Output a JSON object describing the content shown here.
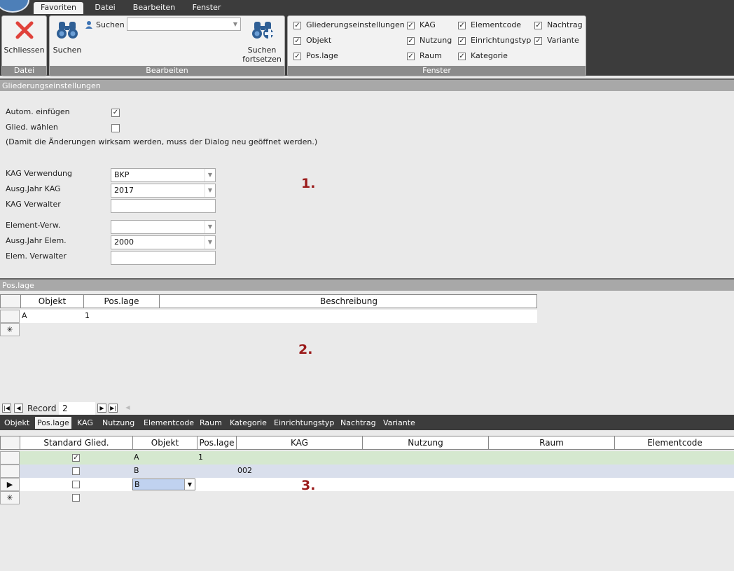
{
  "ribbon": {
    "tabs": [
      "Favoriten",
      "Datei",
      "Bearbeiten",
      "Fenster"
    ],
    "active_tab": "Favoriten",
    "datei_group": {
      "caption": "Datei",
      "close_label": "Schliessen"
    },
    "bearbeiten_group": {
      "caption": "Bearbeiten",
      "search_label": "Suchen",
      "search_field_label": "Suchen",
      "search_field_value": "",
      "continue_label_line1": "Suchen",
      "continue_label_line2": "fortsetzen"
    },
    "fenster_group": {
      "caption": "Fenster",
      "checkboxes": [
        {
          "label": "Gliederungseinstellungen",
          "checked": true
        },
        {
          "label": "Objekt",
          "checked": true
        },
        {
          "label": "Pos.lage",
          "checked": true
        },
        {
          "label": "KAG",
          "checked": true
        },
        {
          "label": "Nutzung",
          "checked": true
        },
        {
          "label": "Raum",
          "checked": true
        },
        {
          "label": "Elementcode",
          "checked": true
        },
        {
          "label": "Einrichtungstyp",
          "checked": true
        },
        {
          "label": "Kategorie",
          "checked": true
        },
        {
          "label": "Nachtrag",
          "checked": true
        },
        {
          "label": "Variante",
          "checked": true
        }
      ]
    }
  },
  "settings": {
    "header": "Gliederungseinstellungen",
    "auto_insert_label": "Autom. einfügen",
    "auto_insert_checked": true,
    "select_label": "Glied. wählen",
    "select_checked": false,
    "note": "(Damit die Änderungen wirksam werden, muss der Dialog neu geöffnet werden.)",
    "kag_usage_label": "KAG Verwendung",
    "kag_usage_value": "BKP",
    "kag_year_label": "Ausg.Jahr KAG",
    "kag_year_value": "2017",
    "kag_admin_label": "KAG Verwalter",
    "kag_admin_value": "",
    "element_usage_label": "Element-Verw.",
    "element_usage_value": "",
    "element_year_label": "Ausg.Jahr Elem.",
    "element_year_value": "2000",
    "element_admin_label": "Elem. Verwalter",
    "element_admin_value": "",
    "marker": "1."
  },
  "poslage": {
    "header": "Pos.lage",
    "columns": [
      "Objekt",
      "Pos.lage",
      "Beschreibung"
    ],
    "rows": [
      {
        "objekt": "A",
        "poslage": "1",
        "beschreibung": ""
      }
    ],
    "new_row_symbol": "✳",
    "marker": "2.",
    "nav": {
      "record_label": "Record",
      "record_value": "2"
    }
  },
  "bottom": {
    "tabs": [
      "Objekt",
      "Pos.lage",
      "KAG",
      "Nutzung",
      "Elementcode",
      "Raum",
      "Kategorie",
      "Einrichtungstyp",
      "Nachtrag",
      "Variante"
    ],
    "active_tab": "Pos.lage",
    "columns": [
      "Standard Glied.",
      "Objekt",
      "Pos.lage",
      "KAG",
      "Nutzung",
      "Raum",
      "Elementcode"
    ],
    "rows": [
      {
        "standard": true,
        "objekt": "A",
        "poslage": "1",
        "kag": ""
      },
      {
        "standard": false,
        "objekt": "B",
        "poslage": "",
        "kag": "002"
      },
      {
        "standard": false,
        "objekt": "B",
        "poslage": "",
        "kag": ""
      },
      {
        "standard": false,
        "objekt": "",
        "poslage": "",
        "kag": ""
      }
    ],
    "current_row_symbol": "▶",
    "new_row_symbol": "✳",
    "marker": "3.",
    "colors": {
      "row1": "#d5e8cf",
      "row2": "#d9dfec",
      "active_cell": "#c0d2f0"
    }
  }
}
